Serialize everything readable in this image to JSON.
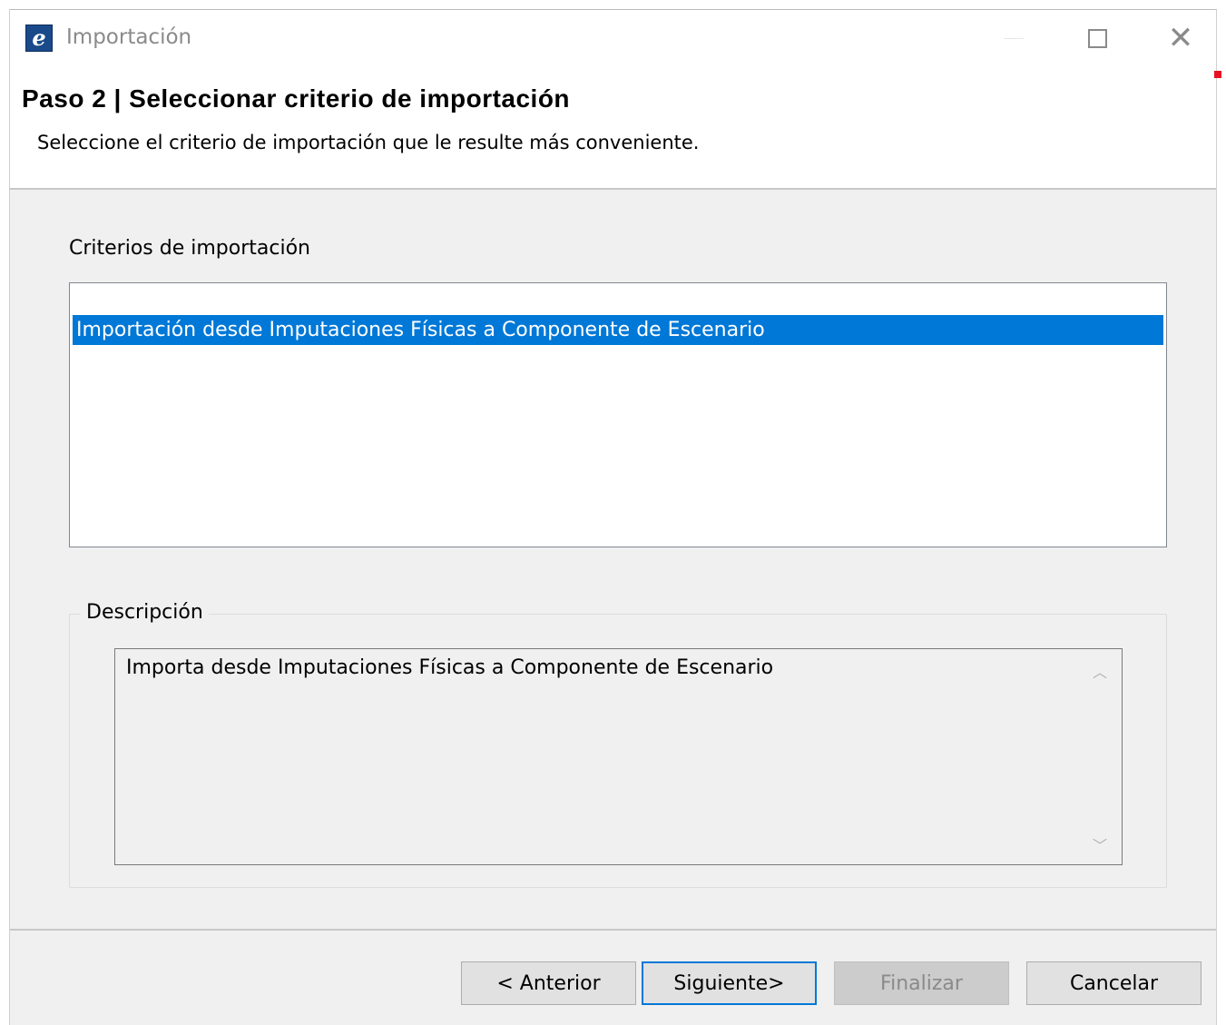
{
  "window": {
    "title": "Importación",
    "icon": "app-logo-icon"
  },
  "header": {
    "step_title": "Paso 2 | Seleccionar criterio de importación",
    "subtitle": "Seleccione el criterio de importación que le resulte más conveniente."
  },
  "criteria": {
    "label": "Criterios de importación",
    "items": [
      {
        "label": "Importación desde Imputaciones Físicas a Componente de Escenario",
        "selected": true
      }
    ]
  },
  "description": {
    "legend": "Descripción",
    "text": "Importa desde Imputaciones Físicas a Componente de Escenario"
  },
  "buttons": {
    "previous": "< Anterior",
    "next": "Siguiente>",
    "finish": "Finalizar",
    "cancel": "Cancelar"
  },
  "colors": {
    "selection": "#0078d7",
    "background": "#f0f0f0"
  }
}
